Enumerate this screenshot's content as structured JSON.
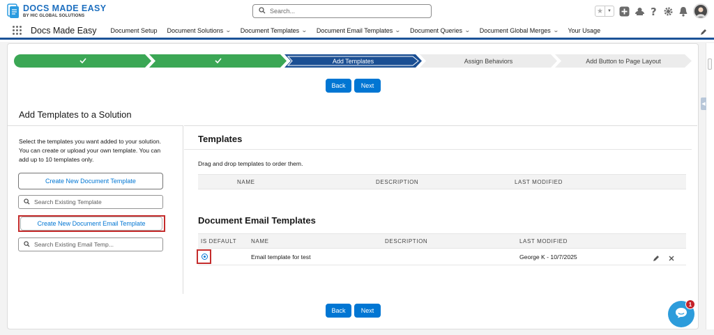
{
  "brand": {
    "title": "DOCS MADE EASY",
    "subtitle": "BY HIC GLOBAL SOLUTIONS"
  },
  "search": {
    "placeholder": "Search..."
  },
  "nav": {
    "app_name": "Docs Made Easy",
    "items": [
      {
        "label": "Document Setup",
        "has_menu": false
      },
      {
        "label": "Document Solutions",
        "has_menu": true
      },
      {
        "label": "Document Templates",
        "has_menu": true
      },
      {
        "label": "Document Email Templates",
        "has_menu": true
      },
      {
        "label": "Document Queries",
        "has_menu": true
      },
      {
        "label": "Document Global Merges",
        "has_menu": true
      },
      {
        "label": "Your Usage",
        "has_menu": false
      }
    ]
  },
  "path": {
    "steps": [
      {
        "label": "",
        "state": "complete",
        "icon": "checkmark-icon"
      },
      {
        "label": "",
        "state": "complete",
        "icon": "checkmark-icon"
      },
      {
        "label": "Add Templates",
        "state": "current"
      },
      {
        "label": "Assign Behaviors",
        "state": "incomplete"
      },
      {
        "label": "Add Button to Page Layout",
        "state": "incomplete"
      }
    ]
  },
  "buttons": {
    "back": "Back",
    "next": "Next"
  },
  "page": {
    "title": "Add Templates to a Solution"
  },
  "left": {
    "instructions": "Select the templates you want added to your solution. You can create or upload your own template. You can add up to 10 templates only.",
    "create_doc_template": "Create New Document Template",
    "search_template_placeholder": "Search Existing Template",
    "create_email_template": "Create New Document Email Template",
    "search_email_placeholder": "Search Existing Email Temp..."
  },
  "templates": {
    "heading": "Templates",
    "hint": "Drag and drop templates to order them.",
    "columns": [
      "NAME",
      "DESCRIPTION",
      "LAST MODIFIED"
    ]
  },
  "email_templates": {
    "heading": "Document Email Templates",
    "columns": [
      "IS DEFAULT",
      "NAME",
      "DESCRIPTION",
      "LAST MODIFIED"
    ],
    "rows": [
      {
        "is_default": true,
        "name": "Email template for test",
        "description": "",
        "last_modified": "George K - 10/7/2025"
      }
    ]
  },
  "chat": {
    "badge": "1"
  },
  "colors": {
    "brand": "#0176d3",
    "complete": "#3ba755",
    "current": "#1b4f93",
    "highlight": "#c42c2c"
  }
}
